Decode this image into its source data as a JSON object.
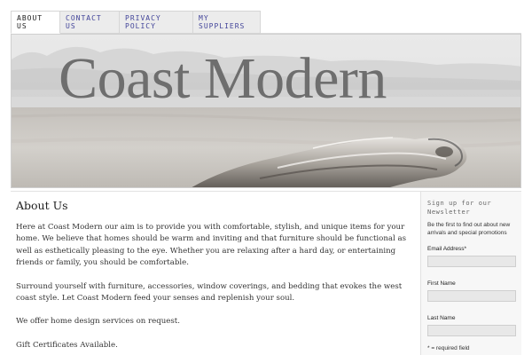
{
  "nav": {
    "tabs": [
      {
        "line1": "About",
        "line2": "Us",
        "active": true
      },
      {
        "line1": "Contact",
        "line2": "Us",
        "active": false
      },
      {
        "line1": "Privacy",
        "line2": "Policy",
        "active": false
      },
      {
        "line1": "My",
        "line2": "Suppliers",
        "active": false
      }
    ]
  },
  "banner": {
    "title": "Coast Modern"
  },
  "main": {
    "heading": "About Us",
    "paragraphs": [
      "Here at Coast Modern our aim is to provide you with comfortable, stylish, and unique items for your home. We believe that homes should be warm and inviting and that furniture should be functional as well as esthetically pleasing to the eye. Whether you are relaxing after a hard day, or entertaining friends or family, you should be comfortable.",
      "Surround yourself with furniture, accessories, window coverings, and bedding that evokes the west coast style.  Let Coast Modern feed your senses and replenish your soul.",
      "We offer home design services on request.",
      "Gift Certificates Available."
    ]
  },
  "newsletter": {
    "title": "Sign up for our Newsletter",
    "intro": "Be the first to find out about new arrivals and special promotions",
    "email_label": "Email Address*",
    "first_name_label": "First Name",
    "last_name_label": "Last Name",
    "required_note": "* = required field"
  }
}
